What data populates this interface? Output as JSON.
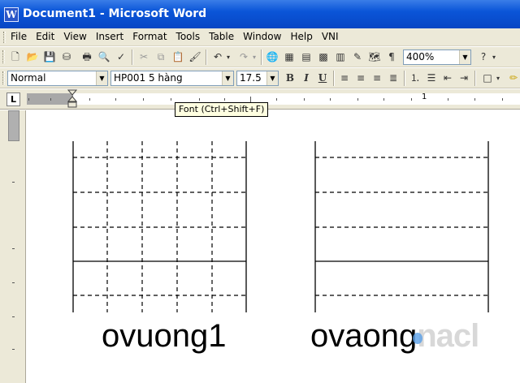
{
  "window": {
    "title": "Document1 - Microsoft Word",
    "app_icon": "word-doc-icon"
  },
  "menu": {
    "items": [
      "File",
      "Edit",
      "View",
      "Insert",
      "Format",
      "Tools",
      "Table",
      "Window",
      "Help",
      "VNI"
    ]
  },
  "standard_toolbar": {
    "zoom": "400%",
    "help_label": "?"
  },
  "formatting_toolbar": {
    "style": "Normal",
    "font": "HP001 5 hàng",
    "size": "17.5",
    "bold": "B",
    "italic": "I",
    "underline": "U"
  },
  "ruler": {
    "tab_selector": "L",
    "number_1": "1"
  },
  "tooltip": "Font (Ctrl+Shift+F)",
  "document": {
    "caption_left": "ovuong1",
    "caption_right": "ovaong",
    "caption_right_faded": "nacl"
  },
  "colors": {
    "titlebar": "#0a55d8",
    "chrome": "#ece9d8"
  }
}
